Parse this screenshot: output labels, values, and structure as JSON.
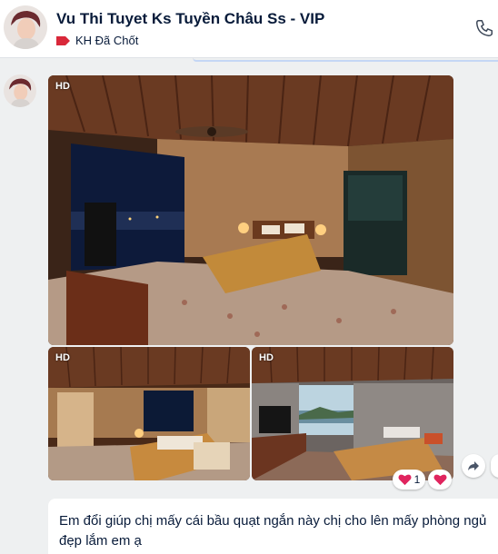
{
  "conversation": {
    "title": "Vu Thi Tuyet Ks Tuyền Châu Ss - VIP",
    "tag_label": "KH Đã Chốt",
    "tag_color": "#d9283a",
    "call_icon": "phone-icon"
  },
  "message": {
    "photos": [
      {
        "badge": "HD",
        "scene": "bedroom-night-balcony"
      },
      {
        "badge": "HD",
        "scene": "bedroom-night-window"
      },
      {
        "badge": "HD",
        "scene": "bedroom-day-seaview"
      }
    ],
    "reactions": {
      "icon": "heart-icon",
      "count": "1"
    },
    "text_lines": [
      "Em đổi giúp chị mấy cái bầu quạt ngắn này chị cho lên mấy phòng ngủ",
      "đẹp lắm em ạ"
    ]
  },
  "colors": {
    "background": "#eef0f1",
    "text": "#081b3a",
    "heart": "#e0245e"
  }
}
